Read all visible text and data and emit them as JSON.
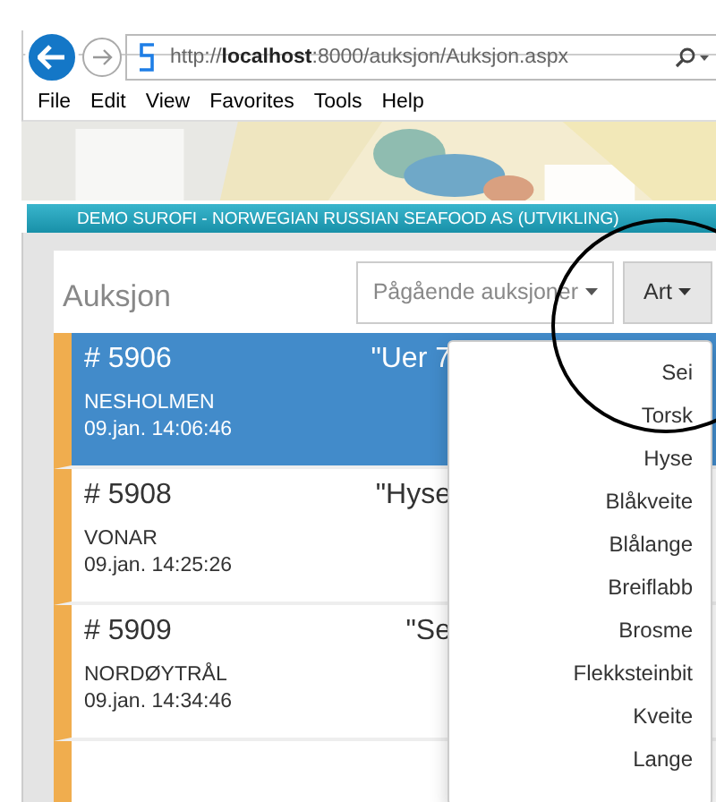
{
  "browser": {
    "url_prefix": "http://",
    "url_host": "localhost",
    "url_rest": ":8000/auksjon/Auksjon.aspx"
  },
  "menu": [
    "File",
    "Edit",
    "View",
    "Favorites",
    "Tools",
    "Help"
  ],
  "banner": {
    "text": "DEMO SUROFI - NORWEGIAN RUSSIAN SEAFOOD AS (UTVIKLING)"
  },
  "page": {
    "title": "Auksjon",
    "filter_button": "Pågående auksjoner",
    "art_button": "Art"
  },
  "auctions": [
    {
      "number": "# 5906",
      "title": "\"Uer 7",
      "vessel": "NESHOLMEN",
      "time": "09.jan. 14:06:46",
      "selected": true
    },
    {
      "number": "# 5908",
      "title": "\"Hyse",
      "vessel": "VONAR",
      "time": "09.jan. 14:25:26",
      "selected": false
    },
    {
      "number": "# 5909",
      "title": "\"Se",
      "vessel": "NORDØYTRÅL",
      "time": "09.jan. 14:34:46",
      "selected": false
    },
    {
      "selected": false
    }
  ],
  "art_menu": [
    "Sei",
    "Torsk",
    "Hyse",
    "Blåkveite",
    "Blålange",
    "Breiflabb",
    "Brosme",
    "Flekksteinbit",
    "Kveite",
    "Lange"
  ]
}
